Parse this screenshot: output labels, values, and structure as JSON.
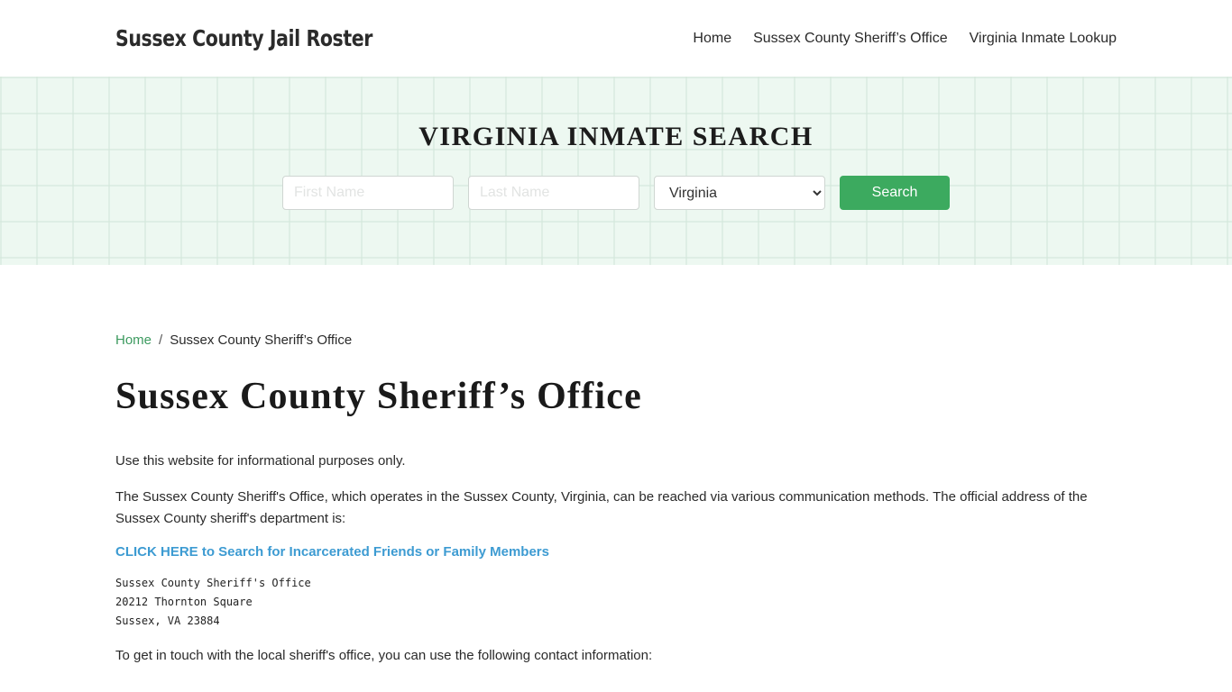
{
  "header": {
    "brand": "Sussex County Jail Roster",
    "nav": [
      {
        "label": "Home"
      },
      {
        "label": "Sussex County Sheriff’s Office"
      },
      {
        "label": "Virginia Inmate Lookup"
      }
    ]
  },
  "hero": {
    "title": "VIRGINIA INMATE SEARCH",
    "first_name_placeholder": "First Name",
    "last_name_placeholder": "Last Name",
    "state_selected": "Virginia",
    "search_label": "Search"
  },
  "breadcrumb": {
    "home": "Home",
    "separator": "/",
    "current": "Sussex County Sheriff’s Office"
  },
  "main": {
    "title": "Sussex County Sheriff’s Office",
    "para1": "Use this website for informational purposes only.",
    "para2": "The Sussex County Sheriff's Office, which operates in the Sussex County, Virginia, can be reached via various communication methods. The official address of the Sussex County sheriff's department is:",
    "cta": "CLICK HERE to Search for Incarcerated Friends or Family Members",
    "address": [
      "Sussex County Sheriff's Office",
      "20212 Thornton Square",
      "Sussex, VA 23884"
    ],
    "para3": "To get in touch with the local sheriff's office, you can use the following contact information:"
  },
  "colors": {
    "accent_green": "#3caa5f",
    "link_blue": "#3d9bd2",
    "hero_bg": "#edf8f1"
  }
}
